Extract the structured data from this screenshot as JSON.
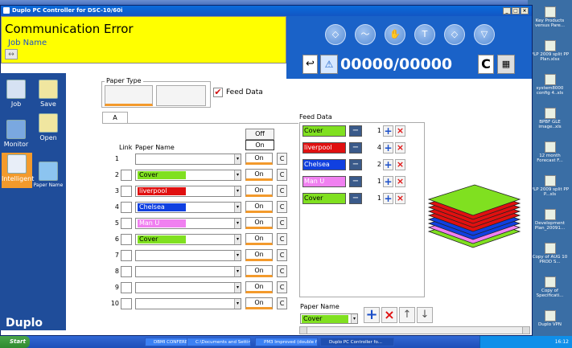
{
  "window": {
    "title": "Duplo PC Controller for DSC-10/60i",
    "min": "_",
    "max": "□",
    "close": "×"
  },
  "header": {
    "status": "Communication Error",
    "job_label": "Job Name",
    "counter": "00000/00000",
    "counter_c": "C",
    "return_icon": "↩",
    "warning_icon": "⚠",
    "arrows_icon": "↔",
    "tool_glyphs": {
      "t": "T"
    }
  },
  "sidebar": {
    "items": [
      {
        "label": "Job"
      },
      {
        "label": "Save"
      },
      {
        "label": "Monitor"
      },
      {
        "label": "Open"
      },
      {
        "label": "Intelligent"
      },
      {
        "label": "Paper Name"
      }
    ],
    "brand": "Duplo"
  },
  "paper_type": {
    "label": "Paper Type",
    "feed_data_label": "Feed Data"
  },
  "tab": {
    "label": "A"
  },
  "table": {
    "link_header": "Link",
    "name_header": "Paper Name",
    "off_label": "Off",
    "on_label": "On",
    "c_label": "C",
    "rows": [
      {
        "num": "1",
        "name": "",
        "color": ""
      },
      {
        "num": "2",
        "name": "Cover",
        "color": "#80e020"
      },
      {
        "num": "3",
        "name": "liverpool",
        "color": "#e01010"
      },
      {
        "num": "4",
        "name": "Chelsea",
        "color": "#1040e0"
      },
      {
        "num": "5",
        "name": "Man U",
        "color": "#f080f0"
      },
      {
        "num": "6",
        "name": "Cover",
        "color": "#80e020"
      },
      {
        "num": "7",
        "name": "",
        "color": ""
      },
      {
        "num": "8",
        "name": "",
        "color": ""
      },
      {
        "num": "9",
        "name": "",
        "color": ""
      },
      {
        "num": "10",
        "name": "",
        "color": ""
      }
    ]
  },
  "feed": {
    "title": "Feed Data",
    "rows": [
      {
        "name": "Cover",
        "count": "1",
        "color": "#80e020",
        "text": "#000"
      },
      {
        "name": "liverpool",
        "count": "4",
        "color": "#e01010",
        "text": "#fff"
      },
      {
        "name": "Chelsea",
        "count": "2",
        "color": "#1040e0",
        "text": "#fff"
      },
      {
        "name": "Man U",
        "count": "1",
        "color": "#f080f0",
        "text": "#fff"
      },
      {
        "name": "Cover",
        "count": "1",
        "color": "#80e020",
        "text": "#000"
      }
    ],
    "paper_name_label": "Paper Name",
    "paper_name_value": "Cover",
    "minus": "−",
    "plus": "+",
    "x": "×",
    "up": "↑",
    "down": "↓"
  },
  "desktop": {
    "icons": [
      "Key Products versus Pare...",
      "PLP 2009 split PP Plan.xlsx",
      "system8000 config 4..xls",
      "BPBF GLE image..xls",
      "12 month Forecast F...",
      "PLP 2009 split PP P...xls",
      "Development Plan_20091...",
      "Copy of AUG 10 PROD S...",
      "Copy of Specificati...",
      "Duplo VPN"
    ]
  },
  "taskbar": {
    "start": "Start",
    "tasks": [
      "DBMI CONFERENCE.ppt ...",
      "C:\\Documents and Settin...",
      "PM3 Improved (double f...",
      "Duplo PC Controller fo..."
    ],
    "clock": "16:12"
  }
}
